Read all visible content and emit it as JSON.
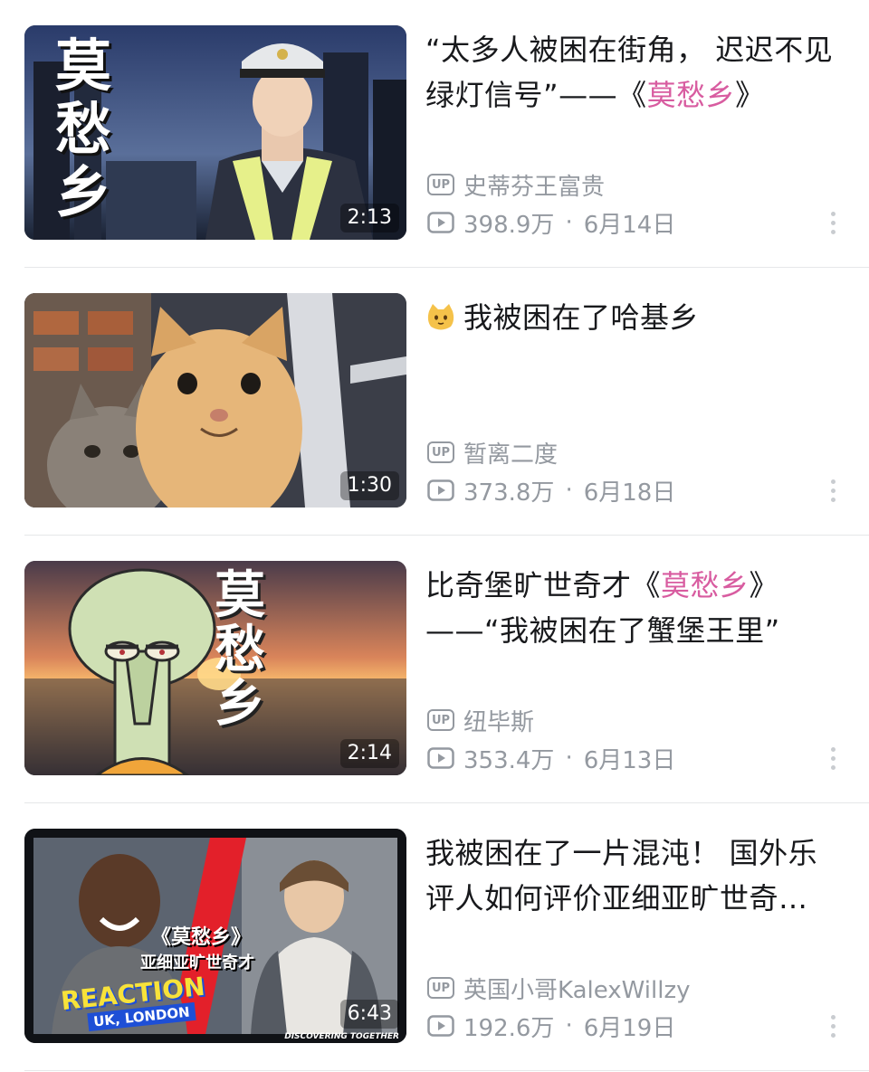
{
  "videos": [
    {
      "title_prefix": "“太多人被困在街角， 迟迟不见绿灯信号”——《",
      "title_highlight": "莫愁乡",
      "title_suffix": "》",
      "thumb_text": "莫愁乡",
      "duration": "2:13",
      "up_badge": "UP",
      "uploader": "史蒂芬王富贵",
      "views": "398.9万",
      "date": "6月14日"
    },
    {
      "title_prefix": "我被困在了哈基乡",
      "title_highlight": "",
      "title_suffix": "",
      "emoji": "cat-face-icon",
      "duration": "1:30",
      "up_badge": "UP",
      "uploader": "暂离二度",
      "views": "373.8万",
      "date": "6月18日"
    },
    {
      "title_prefix": "比奇堡旷世奇才《",
      "title_highlight": "莫愁乡",
      "title_suffix": "》——“我被困在了蟹堡王里”",
      "thumb_text": "莫愁乡",
      "duration": "2:14",
      "up_badge": "UP",
      "uploader": "纽毕斯",
      "views": "353.4万",
      "date": "6月13日"
    },
    {
      "title_prefix": "我被困在了一片混沌！ 国外乐评人如何评价亚细亚旷世奇…",
      "title_highlight": "",
      "title_suffix": "",
      "thumb_title": "《莫愁乡》",
      "thumb_subtitle": "亚细亚旷世奇才",
      "thumb_reaction": "REACTION",
      "thumb_location": "UK, LONDON",
      "thumb_tag": "DISCOVERING TOGETHER",
      "duration": "6:43",
      "up_badge": "UP",
      "uploader": "英国小哥KalexWillzy",
      "views": "192.6万",
      "date": "6月19日"
    }
  ],
  "separator": "·",
  "colors": {
    "highlight": "#d85ca0",
    "meta": "#9499a0",
    "divider": "#e6e7e9"
  }
}
